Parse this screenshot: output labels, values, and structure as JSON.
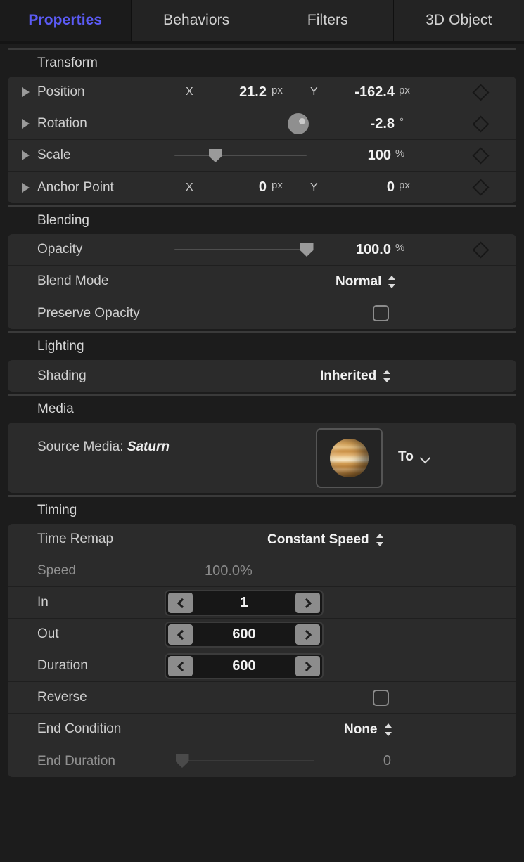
{
  "tabs": [
    {
      "label": "Properties",
      "active": true
    },
    {
      "label": "Behaviors",
      "active": false
    },
    {
      "label": "Filters",
      "active": false
    },
    {
      "label": "3D Object",
      "active": false
    }
  ],
  "accent_color": "#5b5bf5",
  "sections": {
    "transform": {
      "title": "Transform",
      "position": {
        "label": "Position",
        "x_axis": "X",
        "x_value": "21.2",
        "x_unit": "px",
        "y_axis": "Y",
        "y_value": "-162.4",
        "y_unit": "px"
      },
      "rotation": {
        "label": "Rotation",
        "value": "-2.8",
        "unit": "°"
      },
      "scale": {
        "label": "Scale",
        "value": "100",
        "unit": "%"
      },
      "anchor_point": {
        "label": "Anchor Point",
        "x_axis": "X",
        "x_value": "0",
        "x_unit": "px",
        "y_axis": "Y",
        "y_value": "0",
        "y_unit": "px"
      }
    },
    "blending": {
      "title": "Blending",
      "opacity": {
        "label": "Opacity",
        "value": "100.0",
        "unit": "%"
      },
      "blend_mode": {
        "label": "Blend Mode",
        "value": "Normal"
      },
      "preserve_opacity": {
        "label": "Preserve Opacity",
        "checked": false
      }
    },
    "lighting": {
      "title": "Lighting",
      "shading": {
        "label": "Shading",
        "value": "Inherited"
      }
    },
    "media": {
      "title": "Media",
      "source_media_prefix": "Source Media: ",
      "source_media_name": "Saturn",
      "to_menu_label": "To"
    },
    "timing": {
      "title": "Timing",
      "time_remap": {
        "label": "Time Remap",
        "value": "Constant Speed"
      },
      "speed": {
        "label": "Speed",
        "value": "100.0%"
      },
      "in": {
        "label": "In",
        "value": "1"
      },
      "out": {
        "label": "Out",
        "value": "600"
      },
      "duration": {
        "label": "Duration",
        "value": "600"
      },
      "reverse": {
        "label": "Reverse",
        "checked": false
      },
      "end_condition": {
        "label": "End Condition",
        "value": "None"
      },
      "end_duration": {
        "label": "End Duration",
        "value": "0"
      }
    }
  }
}
